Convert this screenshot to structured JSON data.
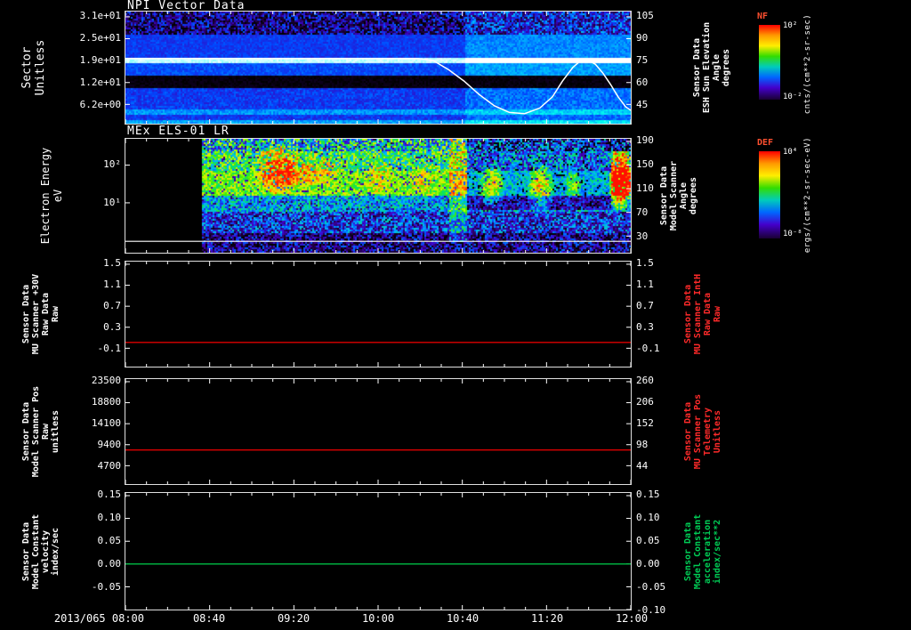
{
  "colors": {
    "background": "#000000",
    "frame": "#ffffff",
    "red_line": "#dd0000",
    "green_line": "#00bb44",
    "red_label": "#ff2a2a",
    "green_label": "#00cc55",
    "colorbar_title": "#ff5030"
  },
  "x_axis": {
    "first_label": "2013/065 08:00",
    "labels": [
      "08:40",
      "09:20",
      "10:00",
      "10:40",
      "11:20",
      "12:00"
    ]
  },
  "colorbars": [
    {
      "name": "NF",
      "tick_top": "10²",
      "tick_bottom": "10⁻²",
      "unit": "cnts/(cm**2-sr-sec)"
    },
    {
      "name": "DEF",
      "tick_top": "10⁴",
      "tick_bottom": "10⁻⁸",
      "unit": "ergs/(cm**2-sr-sec-eV)"
    }
  ],
  "panels": [
    {
      "title": "NPI Vector Data",
      "left_label_lines": [
        "Sector",
        "Unitless"
      ],
      "right_label_lines": [
        "Sensor Data",
        "ESH Sun Elevation",
        "Angle",
        "degrees"
      ],
      "right_label_color": "#ffffff",
      "left_ticks": [
        {
          "label": "3.1e+01",
          "frac": 0.047
        },
        {
          "label": "2.5e+01",
          "frac": 0.242
        },
        {
          "label": "1.9e+01",
          "frac": 0.437
        },
        {
          "label": "1.2e+01",
          "frac": 0.633
        },
        {
          "label": "6.2e+00",
          "frac": 0.828
        }
      ],
      "right_ticks": [
        {
          "label": "105",
          "frac": 0.047
        },
        {
          "label": "90",
          "frac": 0.242
        },
        {
          "label": "75",
          "frac": 0.437
        },
        {
          "label": "60",
          "frac": 0.633
        },
        {
          "label": "45",
          "frac": 0.828
        }
      ],
      "spectrogram": {
        "gap_end": 0,
        "colormap": [
          [
            0,
            "#000000"
          ],
          [
            0.15,
            "#200044"
          ],
          [
            0.3,
            "#3a00bb"
          ],
          [
            0.5,
            "#0048ff"
          ],
          [
            0.65,
            "#00a8ff"
          ],
          [
            0.8,
            "#00ffee"
          ],
          [
            0.9,
            "#b0ffff"
          ],
          [
            1,
            "#ffffff"
          ]
        ],
        "bands": [
          {
            "y0": 0.0,
            "y1": 0.2,
            "base": 0.25,
            "noise": 0.3
          },
          {
            "y0": 0.2,
            "y1": 0.4,
            "base": 0.46,
            "noise": 0.07
          },
          {
            "y0": 0.4,
            "y1": 0.46,
            "base": 0.93,
            "noise": 0.05
          },
          {
            "y0": 0.46,
            "y1": 0.56,
            "base": 0.5,
            "noise": 0.07
          },
          {
            "y0": 0.56,
            "y1": 0.68,
            "base": 0.03,
            "noise": 0.04
          },
          {
            "y0": 0.68,
            "y1": 0.86,
            "base": 0.46,
            "noise": 0.09
          },
          {
            "y0": 0.86,
            "y1": 0.92,
            "base": 0.62,
            "noise": 0.08
          },
          {
            "y0": 0.92,
            "y1": 0.96,
            "base": 0.45,
            "noise": 0.08
          },
          {
            "y0": 0.96,
            "y1": 1.0,
            "base": 0.65,
            "noise": 0.08
          }
        ],
        "features": [
          {
            "x0": 0.67,
            "x1": 1.0,
            "y0": 0.0,
            "y1": 0.56,
            "add": 0.14,
            "soft": false
          },
          {
            "x0": 0.67,
            "x1": 1.0,
            "y0": 0.68,
            "y1": 1.0,
            "add": 0.1,
            "soft": false
          }
        ]
      },
      "overlay": {
        "color": "#ffffff",
        "width": 1.5,
        "points": [
          [
            0,
            0.42
          ],
          [
            0.58,
            0.42
          ],
          [
            0.61,
            0.44
          ],
          [
            0.64,
            0.52
          ],
          [
            0.67,
            0.62
          ],
          [
            0.7,
            0.74
          ],
          [
            0.73,
            0.84
          ],
          [
            0.76,
            0.9
          ],
          [
            0.79,
            0.91
          ],
          [
            0.82,
            0.86
          ],
          [
            0.845,
            0.76
          ],
          [
            0.865,
            0.62
          ],
          [
            0.885,
            0.5
          ],
          [
            0.9,
            0.44
          ],
          [
            0.915,
            0.43
          ],
          [
            0.93,
            0.47
          ],
          [
            0.945,
            0.55
          ],
          [
            0.96,
            0.65
          ],
          [
            0.975,
            0.76
          ],
          [
            0.99,
            0.85
          ],
          [
            1.0,
            0.88
          ]
        ]
      }
    },
    {
      "title": "MEx ELS-01 LR",
      "left_label_lines": [
        "Electron Energy",
        "eV"
      ],
      "right_label_lines": [
        "Sensor Data",
        "Model Scanner",
        "Angle",
        "degrees"
      ],
      "right_label_color": "#ffffff",
      "left_ticks": [
        {
          "label": "10²",
          "frac": 0.231
        },
        {
          "label": "10¹",
          "frac": 0.562
        }
      ],
      "right_ticks": [
        {
          "label": "190",
          "frac": 0.023
        },
        {
          "label": "150",
          "frac": 0.231
        },
        {
          "label": "110",
          "frac": 0.438
        },
        {
          "label": "70",
          "frac": 0.646
        },
        {
          "label": "30",
          "frac": 0.854
        }
      ],
      "spectrogram": {
        "gap_end": 0.149,
        "colormap": [
          [
            0,
            "#000000"
          ],
          [
            0.1,
            "#26004d"
          ],
          [
            0.22,
            "#4400cc"
          ],
          [
            0.34,
            "#0055ff"
          ],
          [
            0.46,
            "#00bbff"
          ],
          [
            0.56,
            "#00dd77"
          ],
          [
            0.66,
            "#44ee00"
          ],
          [
            0.75,
            "#bbff00"
          ],
          [
            0.83,
            "#ffd500"
          ],
          [
            0.91,
            "#ff7700"
          ],
          [
            1,
            "#ff1100"
          ]
        ],
        "bands": [
          {
            "y0": 0.0,
            "y1": 0.1,
            "base": 0.5,
            "noise": 0.3
          },
          {
            "y0": 0.1,
            "y1": 0.28,
            "base": 0.6,
            "noise": 0.22
          },
          {
            "y0": 0.28,
            "y1": 0.5,
            "base": 0.68,
            "noise": 0.14
          },
          {
            "y0": 0.5,
            "y1": 0.64,
            "base": 0.44,
            "noise": 0.18
          },
          {
            "y0": 0.64,
            "y1": 0.82,
            "base": 0.3,
            "noise": 0.22
          },
          {
            "y0": 0.82,
            "y1": 1.0,
            "base": 0.16,
            "noise": 0.22
          }
        ],
        "features": [
          {
            "x0": 0.26,
            "x1": 0.34,
            "y0": 0.05,
            "y1": 0.48,
            "add": 0.3,
            "soft": true
          },
          {
            "x0": 0.3,
            "x1": 0.42,
            "y0": 0.12,
            "y1": 0.42,
            "add": 0.18,
            "soft": true
          },
          {
            "x0": 0.47,
            "x1": 0.53,
            "y0": 0.2,
            "y1": 0.48,
            "add": 0.12,
            "soft": true
          },
          {
            "x0": 0.56,
            "x1": 0.61,
            "y0": 0.18,
            "y1": 0.5,
            "add": 0.12,
            "soft": true
          },
          {
            "x0": 0.64,
            "x1": 0.675,
            "y0": 0.0,
            "y1": 0.9,
            "add": 0.16,
            "soft": false
          },
          {
            "x0": 0.675,
            "x1": 0.96,
            "y0": 0.0,
            "y1": 0.62,
            "add": -0.22,
            "soft": false
          },
          {
            "x0": 0.7,
            "x1": 0.745,
            "y0": 0.22,
            "y1": 0.58,
            "add": 0.34,
            "soft": true
          },
          {
            "x0": 0.795,
            "x1": 0.845,
            "y0": 0.22,
            "y1": 0.62,
            "add": 0.34,
            "soft": true
          },
          {
            "x0": 0.87,
            "x1": 0.9,
            "y0": 0.28,
            "y1": 0.52,
            "add": 0.22,
            "soft": true
          },
          {
            "x0": 0.955,
            "x1": 1.0,
            "y0": 0.1,
            "y1": 0.62,
            "add": 0.55,
            "soft": true
          },
          {
            "x0": 0.95,
            "x1": 1.0,
            "y0": 0.0,
            "y1": 0.1,
            "add": -0.25,
            "soft": false
          }
        ]
      },
      "overlay": {
        "color": "#ffffff",
        "width": 1.2,
        "points": [
          [
            0,
            0.9
          ],
          [
            1,
            0.9
          ]
        ]
      }
    },
    {
      "title": "",
      "left_label_lines": [
        "Sensor Data",
        "MU Scanner +30V",
        "Raw Data",
        "Raw"
      ],
      "right_label_lines": [
        "Sensor Data",
        "MU Scanner IntH",
        "Raw Data",
        "Raw"
      ],
      "right_label_color": "#ff2a2a",
      "left_ticks": [
        {
          "label": "1.5",
          "frac": 0.025
        },
        {
          "label": "1.1",
          "frac": 0.225
        },
        {
          "label": "0.7",
          "frac": 0.425
        },
        {
          "label": "0.3",
          "frac": 0.625
        },
        {
          "label": "-0.1",
          "frac": 0.825
        }
      ],
      "right_ticks": [
        {
          "label": "1.5",
          "frac": 0.025
        },
        {
          "label": "1.1",
          "frac": 0.225
        },
        {
          "label": "0.7",
          "frac": 0.425
        },
        {
          "label": "0.3",
          "frac": 0.625
        },
        {
          "label": "-0.1",
          "frac": 0.825
        }
      ],
      "line": {
        "frac": 0.77,
        "color": "#dd0000"
      }
    },
    {
      "title": "",
      "left_label_lines": [
        "Sensor Data",
        "Model Scanner Pos",
        "Raw",
        "unitless"
      ],
      "right_label_lines": [
        "Sensor Data",
        "MU Scanner Pos",
        "Telemetry",
        "Unitless"
      ],
      "right_label_color": "#ff2a2a",
      "left_ticks": [
        {
          "label": "23500",
          "frac": 0.025
        },
        {
          "label": "18800",
          "frac": 0.225
        },
        {
          "label": "14100",
          "frac": 0.425
        },
        {
          "label": "9400",
          "frac": 0.625
        },
        {
          "label": "4700",
          "frac": 0.825
        }
      ],
      "right_ticks": [
        {
          "label": "260",
          "frac": 0.025
        },
        {
          "label": "206",
          "frac": 0.225
        },
        {
          "label": "152",
          "frac": 0.425
        },
        {
          "label": "98",
          "frac": 0.625
        },
        {
          "label": "44",
          "frac": 0.825
        }
      ],
      "line": {
        "frac": 0.675,
        "color": "#dd0000"
      }
    },
    {
      "title": "",
      "left_label_lines": [
        "Sensor Data",
        "Model Constant",
        "velocity",
        "index/sec"
      ],
      "right_label_lines": [
        "Sensor Data",
        "Model Constant",
        "acceleration",
        "index/sec**2"
      ],
      "right_label_color": "#00cc55",
      "left_ticks": [
        {
          "label": "0.15",
          "frac": 0.023
        },
        {
          "label": "0.10",
          "frac": 0.218
        },
        {
          "label": "0.05",
          "frac": 0.414
        },
        {
          "label": "0.00",
          "frac": 0.609
        },
        {
          "label": "-0.05",
          "frac": 0.805
        }
      ],
      "right_ticks": [
        {
          "label": "0.15",
          "frac": 0.023
        },
        {
          "label": "0.10",
          "frac": 0.218
        },
        {
          "label": "0.05",
          "frac": 0.414
        },
        {
          "label": "0.00",
          "frac": 0.609
        },
        {
          "label": "-0.05",
          "frac": 0.805
        },
        {
          "label": "-0.10",
          "frac": 1.0
        }
      ],
      "line": {
        "frac": 0.609,
        "color": "#00bb44"
      }
    }
  ],
  "chart_data": [
    {
      "type": "heatmap",
      "title": "NPI Vector Data",
      "x_range": [
        "2013/065 08:00",
        "2013/065 12:00"
      ],
      "x_ticks": [
        "08:00",
        "08:40",
        "09:20",
        "10:00",
        "10:40",
        "11:20",
        "12:00"
      ],
      "y_axis_left": {
        "label": "Sector Unitless",
        "ticks": [
          31,
          25,
          19,
          12,
          6.2
        ]
      },
      "y_axis_right": {
        "label": "Sensor Data ESH Sun Elevation Angle degrees",
        "ticks": [
          105,
          90,
          75,
          60,
          45
        ]
      },
      "color_scale": {
        "name": "NF",
        "units": "cnts/(cm**2-sr-sec)",
        "min_label": "10^-2",
        "max_label": "10^2"
      },
      "summary": "Blue/purple count spectrogram vs sector: dark speckled high sectors, bright cyan-white band near sector 19, black band near sectors 10-13, cyan low sectors; overall brightening after ~10:40",
      "overlay_line": {
        "name": "ESH Sun Elevation Angle",
        "color": "#ffffff",
        "units": "degrees",
        "x_hours": [
          8.0,
          10.3,
          10.5,
          10.7,
          10.9,
          11.05,
          11.15,
          11.25,
          11.35,
          11.45,
          11.55,
          11.65,
          11.75,
          11.85,
          12.0
        ],
        "y": [
          75,
          75,
          71,
          62,
          49,
          42,
          40,
          43,
          52,
          64,
          73,
          75,
          69,
          58,
          42
        ]
      }
    },
    {
      "type": "heatmap",
      "title": "MEx ELS-01 LR",
      "x_range": [
        "2013/065 08:00",
        "2013/065 12:00"
      ],
      "x_ticks": [
        "08:00",
        "08:40",
        "09:20",
        "10:00",
        "10:40",
        "11:20",
        "12:00"
      ],
      "y_axis_left": {
        "label": "Electron Energy eV",
        "scale": "log",
        "ticks": [
          100,
          10
        ]
      },
      "y_axis_right": {
        "label": "Sensor Data Model Scanner Angle degrees",
        "ticks": [
          190,
          150,
          110,
          70,
          30
        ]
      },
      "color_scale": {
        "name": "DEF",
        "units": "ergs/(cm**2-sr-sec-eV)",
        "min_label": "10^-8",
        "max_label": "10^4"
      },
      "data_start": "~08:35 (black gap before)",
      "summary": "Yellow-green electron flux band ~10-50 eV with red-orange enhancements ~09:05-09:30, discrete green-cyan blobs ~10:55 and ~11:25, intense red patch ~11:50-12:00; weak blue/dark flux at lowest energies"
    },
    {
      "type": "line",
      "title": "Sensor Data MU Scanner +30V Raw Data Raw",
      "ylim": [
        -0.1,
        1.5
      ],
      "series": [
        {
          "name": "MU Scanner IntH Raw Data Raw",
          "color": "#dd0000",
          "x": [
            "08:00",
            "12:00"
          ],
          "y": [
            0.02,
            0.02
          ]
        }
      ]
    },
    {
      "type": "line",
      "title": "Sensor Data Model Scanner Pos Raw unitless",
      "ylim_left": [
        4700,
        23500
      ],
      "ylim_right": [
        44,
        260
      ],
      "series": [
        {
          "name": "MU Scanner Pos Telemetry",
          "color": "#dd0000",
          "x": [
            "08:00",
            "12:00"
          ],
          "y_left": [
            8200,
            8200
          ],
          "y_right": [
            86,
            86
          ]
        }
      ]
    },
    {
      "type": "line",
      "title": "Sensor Data Model Constant velocity index/sec",
      "ylim": [
        -0.1,
        0.15
      ],
      "series": [
        {
          "name": "Model Constant acceleration index/sec**2",
          "color": "#00bb44",
          "x": [
            "08:00",
            "12:00"
          ],
          "y": [
            0.0,
            0.0
          ]
        }
      ]
    }
  ]
}
